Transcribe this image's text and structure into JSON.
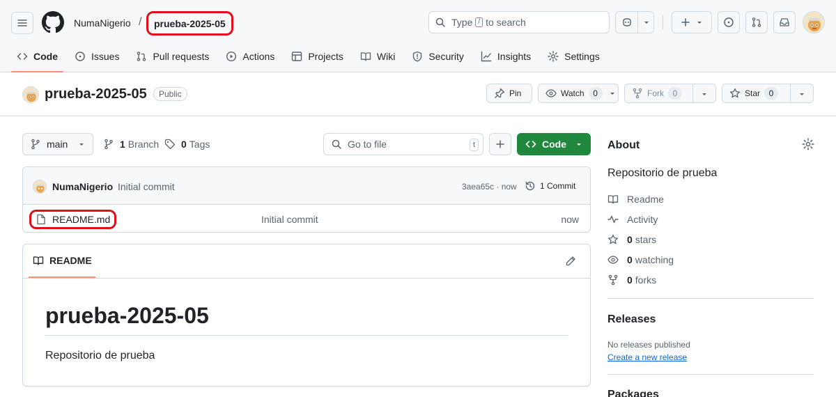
{
  "header": {
    "owner": "NumaNigerio",
    "separator": "/",
    "repo": "prueba-2025-05",
    "search_prefix": "Type",
    "search_key": "/",
    "search_suffix": "to search"
  },
  "tabs": [
    {
      "label": "Code",
      "icon": "code-icon",
      "selected": true
    },
    {
      "label": "Issues",
      "icon": "issue-opened-icon"
    },
    {
      "label": "Pull requests",
      "icon": "git-pull-request-icon"
    },
    {
      "label": "Actions",
      "icon": "play-icon"
    },
    {
      "label": "Projects",
      "icon": "table-icon"
    },
    {
      "label": "Wiki",
      "icon": "book-icon"
    },
    {
      "label": "Security",
      "icon": "shield-icon"
    },
    {
      "label": "Insights",
      "icon": "graph-icon"
    },
    {
      "label": "Settings",
      "icon": "gear-icon"
    }
  ],
  "repo_title": {
    "name": "prueba-2025-05",
    "visibility": "Public",
    "pin_label": "Pin",
    "watch_label": "Watch",
    "watch_count": "0",
    "fork_label": "Fork",
    "fork_count": "0",
    "star_label": "Star",
    "star_count": "0"
  },
  "file_nav": {
    "branch": "main",
    "branch_count": "1",
    "branch_label": "Branch",
    "tag_count": "0",
    "tag_label": "Tags",
    "goto_placeholder": "Go to file",
    "goto_key": "t",
    "code_label": "Code"
  },
  "latest_commit": {
    "author": "NumaNigerio",
    "message": "Initial commit",
    "hash_time": "3aea65c · now",
    "count_label": "1 Commit"
  },
  "files": [
    {
      "name": "README.md",
      "message": "Initial commit",
      "time": "now"
    }
  ],
  "readme": {
    "tab_label": "README",
    "heading": "prueba-2025-05",
    "body": "Repositorio de prueba"
  },
  "about": {
    "title": "About",
    "description": "Repositorio de prueba",
    "readme_label": "Readme",
    "activity_label": "Activity",
    "stars_count": "0",
    "stars_label": "stars",
    "watching_count": "0",
    "watching_label": "watching",
    "forks_count": "0",
    "forks_label": "forks"
  },
  "releases": {
    "title": "Releases",
    "empty_text": "No releases published",
    "create_link": "Create a new release"
  },
  "packages": {
    "title": "Packages"
  },
  "colors": {
    "accent_green": "#1f883d",
    "link_blue": "#0969da",
    "tab_underline": "#fd8c73",
    "highlight_red": "#e0101a"
  }
}
